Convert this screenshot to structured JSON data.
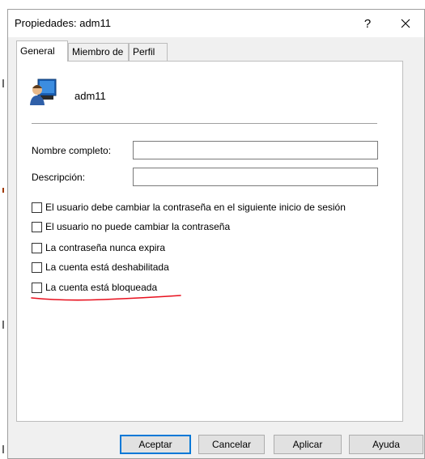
{
  "window": {
    "title": "Propiedades: adm11",
    "help_label": "?"
  },
  "tabs": [
    {
      "label": "General",
      "active": true
    },
    {
      "label": "Miembro de",
      "active": false
    },
    {
      "label": "Perfil",
      "active": false
    }
  ],
  "general": {
    "username": "adm11",
    "fields": {
      "full_name": {
        "label": "Nombre completo:",
        "value": ""
      },
      "description": {
        "label": "Descripción:",
        "value": ""
      }
    },
    "checkboxes": [
      {
        "label": "El usuario debe cambiar la contraseña en el siguiente inicio de sesión",
        "checked": false
      },
      {
        "label": "El usuario no puede cambiar la contraseña",
        "checked": false
      },
      {
        "label": "La contraseña nunca expira",
        "checked": false
      },
      {
        "label": "La cuenta está deshabilitada",
        "checked": false
      },
      {
        "label": "La cuenta está bloqueada",
        "checked": false
      }
    ],
    "annotation_color": "#e8101e"
  },
  "buttons": {
    "ok": "Aceptar",
    "cancel": "Cancelar",
    "apply": "Aplicar",
    "help": "Ayuda"
  },
  "icons": {
    "user": "user-icon",
    "close": "close-icon"
  },
  "colors": {
    "default_button_border": "#0078d7",
    "dialog_background": "#f0f0f0"
  }
}
